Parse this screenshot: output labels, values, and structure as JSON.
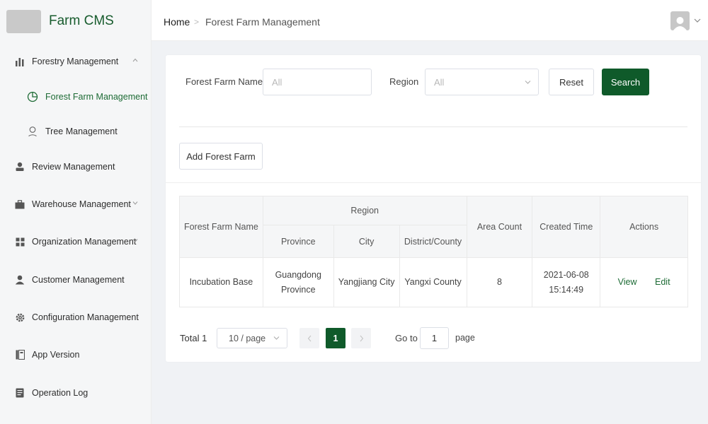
{
  "app": {
    "brand": "Farm CMS"
  },
  "header": {
    "breadcrumb": [
      "Home",
      "Forest Farm Management"
    ]
  },
  "sidebar": {
    "items": [
      {
        "label": "Forestry Management",
        "icon": "bar-chart-icon",
        "expanded": true
      },
      {
        "label": "Forest Farm Management",
        "icon": "pie-chart-icon",
        "active": true,
        "sub": true
      },
      {
        "label": "Tree Management",
        "icon": "location-pin-icon",
        "sub": true
      },
      {
        "label": "Review Management",
        "icon": "user-review-icon"
      },
      {
        "label": "Warehouse Management",
        "icon": "briefcase-icon",
        "expandable": true
      },
      {
        "label": "Organization Management",
        "icon": "grid-icon",
        "expandable": true
      },
      {
        "label": "Customer Management",
        "icon": "person-icon"
      },
      {
        "label": "Configuration Management",
        "icon": "gear-icon"
      },
      {
        "label": "App Version",
        "icon": "version-icon"
      },
      {
        "label": "Operation Log",
        "icon": "log-icon"
      }
    ]
  },
  "filters": {
    "name_label": "Forest Farm Name",
    "name_placeholder": "All",
    "region_label": "Region",
    "region_placeholder": "All",
    "reset_label": "Reset",
    "search_label": "Search"
  },
  "add_button_label": "Add Forest Farm",
  "table": {
    "headers": {
      "name": "Forest Farm Name",
      "region": "Region",
      "province": "Province",
      "city": "City",
      "district": "District/County",
      "area_count": "Area Count",
      "created_time": "Created Time",
      "actions": "Actions"
    },
    "rows": [
      {
        "name": "Incubation Base",
        "province_line1": "Guangdong",
        "province_line2": "Province",
        "city": "Yangjiang City",
        "district": "Yangxi County",
        "area_count": "8",
        "date": "2021-06-08",
        "time": "15:14:49",
        "view_label": "View",
        "edit_label": "Edit"
      }
    ]
  },
  "pagination": {
    "total": "Total 1",
    "page_size": "10 / page",
    "current_page": "1",
    "goto_label": "Go to",
    "goto_value": "1",
    "page_word": "page"
  },
  "colors": {
    "accent": "#0f5a2a",
    "active_text": "#1d6b35"
  }
}
